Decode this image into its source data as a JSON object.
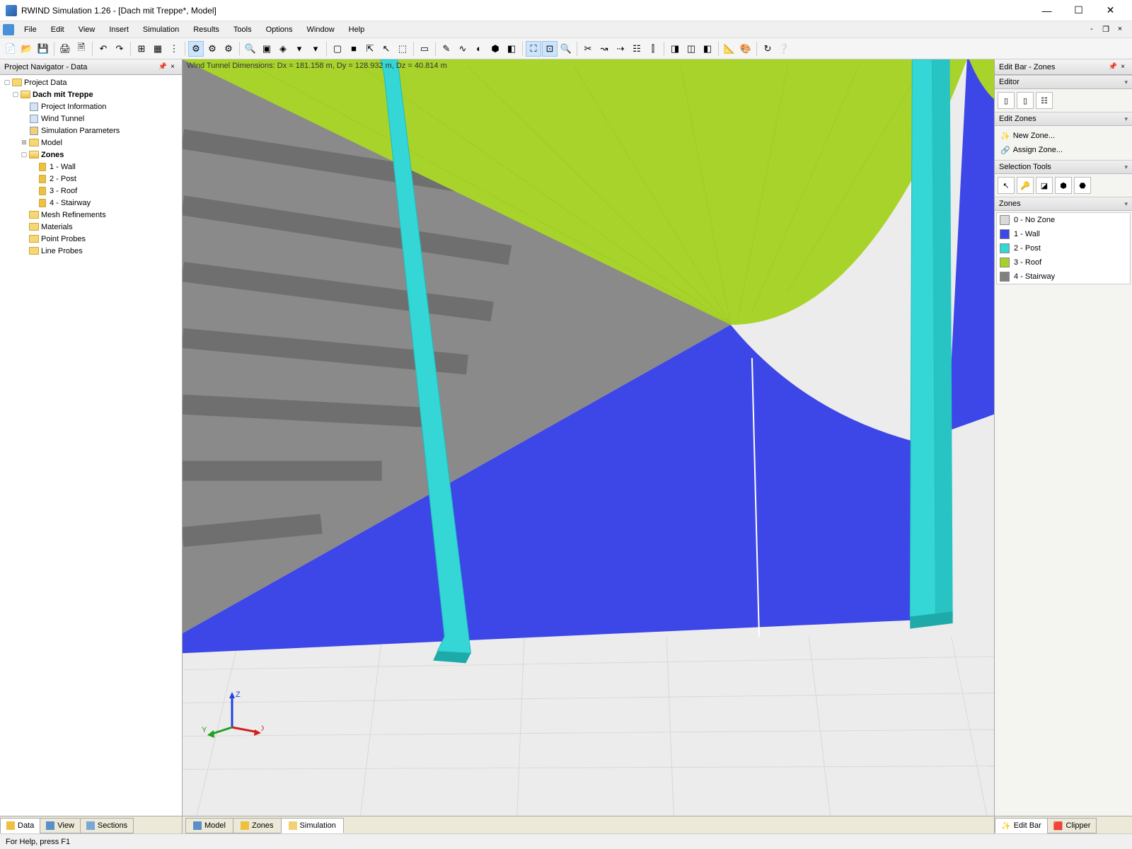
{
  "titlebar": {
    "title": "RWIND Simulation 1.26 - [Dach mit Treppe*, Model]"
  },
  "menu": {
    "items": [
      "File",
      "Edit",
      "View",
      "Insert",
      "Simulation",
      "Results",
      "Tools",
      "Options",
      "Window",
      "Help"
    ]
  },
  "navigator": {
    "title": "Project Navigator - Data",
    "root": "Project Data",
    "project": "Dach mit Treppe",
    "items": {
      "info": "Project Information",
      "wind": "Wind Tunnel",
      "sim": "Simulation Parameters",
      "model": "Model",
      "zones": "Zones",
      "zone1": "1 - Wall",
      "zone2": "2 - Post",
      "zone3": "3 - Roof",
      "zone4": "4 - Stairway",
      "mesh": "Mesh Refinements",
      "materials": "Materials",
      "point": "Point Probes",
      "line": "Line Probes"
    },
    "tabs": {
      "data": "Data",
      "view": "View",
      "sections": "Sections"
    }
  },
  "viewport": {
    "dimensions": "Wind Tunnel Dimensions: Dx = 181.158 m, Dy = 128.932 m, Dz = 40.814 m",
    "tabs": {
      "model": "Model",
      "zones": "Zones",
      "simulation": "Simulation"
    },
    "axes": {
      "x": "X",
      "y": "Y",
      "z": "Z"
    }
  },
  "editbar": {
    "title": "Edit Bar - Zones",
    "sections": {
      "editor": "Editor",
      "editzones": "Edit Zones",
      "seltools": "Selection Tools",
      "zones": "Zones"
    },
    "actions": {
      "newzone": "New Zone...",
      "assign": "Assign Zone..."
    },
    "zones": [
      {
        "label": "0 - No Zone",
        "color": "#d9d9d9"
      },
      {
        "label": "1 - Wall",
        "color": "#3d46e6"
      },
      {
        "label": "2 - Post",
        "color": "#34d6d6"
      },
      {
        "label": "3 - Roof",
        "color": "#a7d129"
      },
      {
        "label": "4 - Stairway",
        "color": "#808080"
      }
    ],
    "tabs": {
      "editbar": "Edit Bar",
      "clipper": "Clipper"
    }
  },
  "status": {
    "help": "For Help, press F1"
  }
}
